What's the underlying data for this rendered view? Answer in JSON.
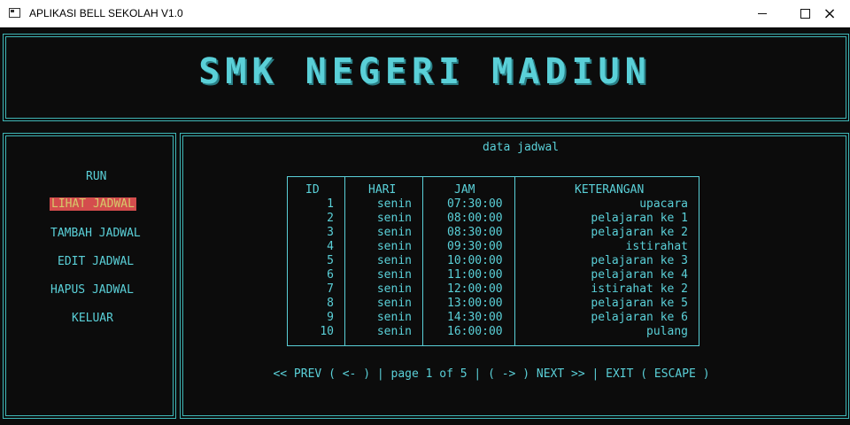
{
  "window": {
    "title": "APLIKASI BELL SEKOLAH V1.0",
    "minimize": "minimize",
    "maximize": "maximize",
    "close": "×"
  },
  "header": {
    "school": "SMK NEGERI MADIUN"
  },
  "menu": {
    "items": [
      "RUN",
      "LIHAT JADWAL",
      "TAMBAH JADWAL",
      "EDIT JADWAL",
      "HAPUS JADWAL",
      "KELUAR"
    ],
    "active": "LIHAT JADWAL"
  },
  "content": {
    "title": "data jadwal",
    "columns": [
      "ID",
      "HARI",
      "JAM",
      "KETERANGAN"
    ],
    "rows": [
      {
        "id": "1",
        "hari": "senin",
        "jam": "07:30:00",
        "ket": "upacara"
      },
      {
        "id": "2",
        "hari": "senin",
        "jam": "08:00:00",
        "ket": "pelajaran ke 1"
      },
      {
        "id": "3",
        "hari": "senin",
        "jam": "08:30:00",
        "ket": "pelajaran ke 2"
      },
      {
        "id": "4",
        "hari": "senin",
        "jam": "09:30:00",
        "ket": "istirahat"
      },
      {
        "id": "5",
        "hari": "senin",
        "jam": "10:00:00",
        "ket": "pelajaran ke 3"
      },
      {
        "id": "6",
        "hari": "senin",
        "jam": "11:00:00",
        "ket": "pelajaran ke 4"
      },
      {
        "id": "7",
        "hari": "senin",
        "jam": "12:00:00",
        "ket": "istirahat ke 2"
      },
      {
        "id": "8",
        "hari": "senin",
        "jam": "13:00:00",
        "ket": "pelajaran ke 5"
      },
      {
        "id": "9",
        "hari": "senin",
        "jam": "14:30:00",
        "ket": "pelajaran ke 6"
      },
      {
        "id": "10",
        "hari": "senin",
        "jam": "16:00:00",
        "ket": "pulang"
      }
    ],
    "pager": "<< PREV ( <- ) | page 1 of 5 | ( -> ) NEXT >> | EXIT ( ESCAPE )"
  },
  "colors": {
    "background": "#0c0c0c",
    "accent": "#5ad0d8",
    "highlight_bg": "#d44d4d",
    "highlight_text": "#d6c96a"
  }
}
